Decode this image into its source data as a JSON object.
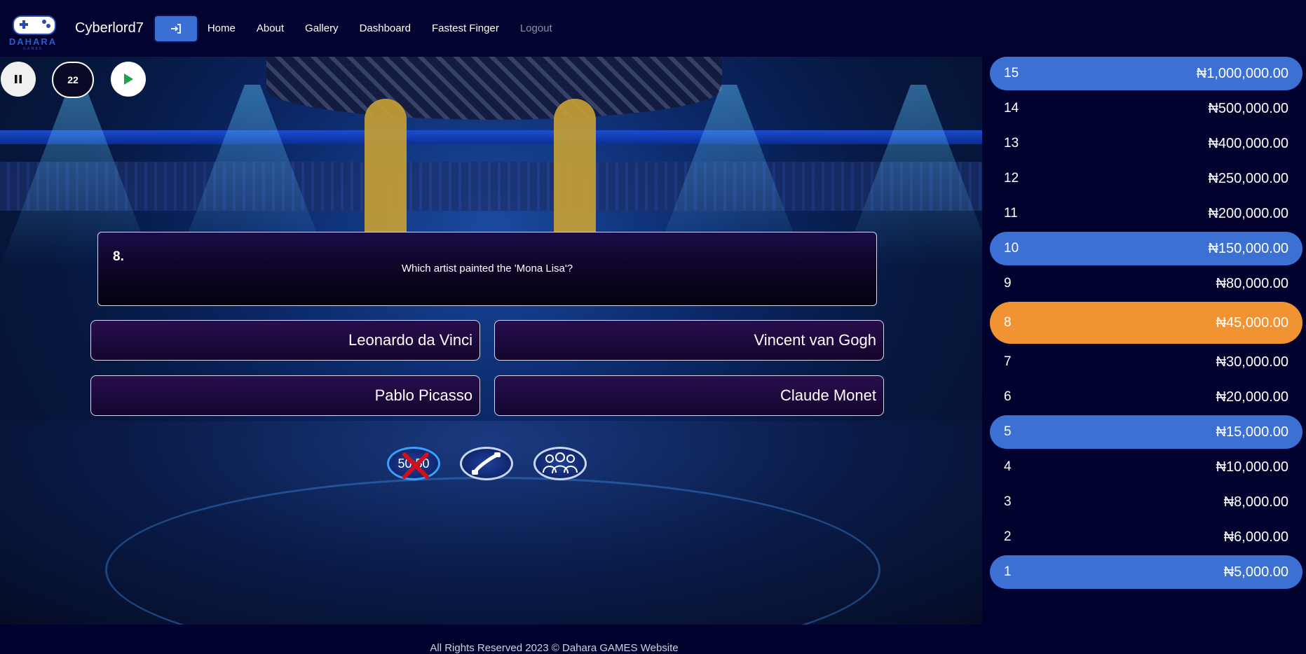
{
  "navbar": {
    "logo_text": "DAHARA",
    "logo_sub": "GAMES",
    "username": "Cyberlord7",
    "links": [
      "Home",
      "About",
      "Gallery",
      "Dashboard",
      "Fastest Finger",
      "Logout"
    ],
    "login_icon": "login-arrow-icon"
  },
  "controls": {
    "pause_icon": "pause-icon",
    "timer": "22",
    "play_icon": "play-icon"
  },
  "question": {
    "number": "8.",
    "text": "Which artist painted the 'Mona Lisa'?"
  },
  "answers": [
    "Leonardo da Vinci",
    "Vincent van Gogh",
    "Pablo Picasso",
    "Claude Monet"
  ],
  "lifelines": {
    "fifty_fifty_label": "50:50",
    "fifty_fifty_used": true,
    "phone_icon": "phone-icon",
    "audience_icon": "audience-icon"
  },
  "ladder": [
    {
      "level": "15",
      "amount": "₦1,000,000.00",
      "state": "milestone"
    },
    {
      "level": "14",
      "amount": "₦500,000.00",
      "state": "normal"
    },
    {
      "level": "13",
      "amount": "₦400,000.00",
      "state": "normal"
    },
    {
      "level": "12",
      "amount": "₦250,000.00",
      "state": "normal"
    },
    {
      "level": "11",
      "amount": "₦200,000.00",
      "state": "normal"
    },
    {
      "level": "10",
      "amount": "₦150,000.00",
      "state": "milestone"
    },
    {
      "level": "9",
      "amount": "₦80,000.00",
      "state": "normal"
    },
    {
      "level": "8",
      "amount": "₦45,000.00",
      "state": "current"
    },
    {
      "level": "7",
      "amount": "₦30,000.00",
      "state": "normal"
    },
    {
      "level": "6",
      "amount": "₦20,000.00",
      "state": "normal"
    },
    {
      "level": "5",
      "amount": "₦15,000.00",
      "state": "milestone"
    },
    {
      "level": "4",
      "amount": "₦10,000.00",
      "state": "normal"
    },
    {
      "level": "3",
      "amount": "₦8,000.00",
      "state": "normal"
    },
    {
      "level": "2",
      "amount": "₦6,000.00",
      "state": "normal"
    },
    {
      "level": "1",
      "amount": "₦5,000.00",
      "state": "milestone"
    }
  ],
  "colors": {
    "milestone": "#3c70d2",
    "current": "#f29333",
    "background": "#02022e"
  },
  "footer": "All Rights Reserved 2023 © Dahara GAMES Website"
}
